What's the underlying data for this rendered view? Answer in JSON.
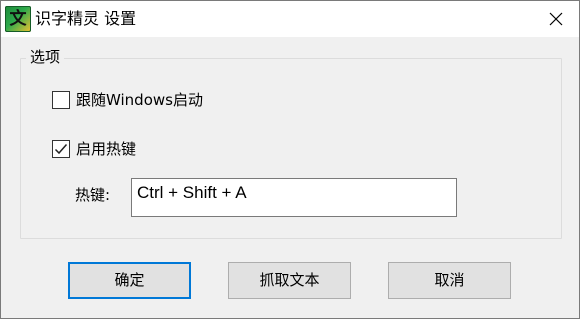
{
  "window": {
    "app_icon_glyph": "文",
    "title": "识字精灵 设置"
  },
  "options": {
    "group_label": "选项",
    "autostart": {
      "label": "跟随Windows启动",
      "checked": false
    },
    "enable_hotkey": {
      "label": "启用热键",
      "checked": true
    },
    "hotkey": {
      "label": "热键:",
      "value": "Ctrl + Shift + A"
    }
  },
  "buttons": {
    "ok": "确定",
    "grab_text": "抓取文本",
    "cancel": "取消"
  },
  "colors": {
    "focus_border": "#0078d7",
    "window_bg": "#f0f0f0"
  }
}
